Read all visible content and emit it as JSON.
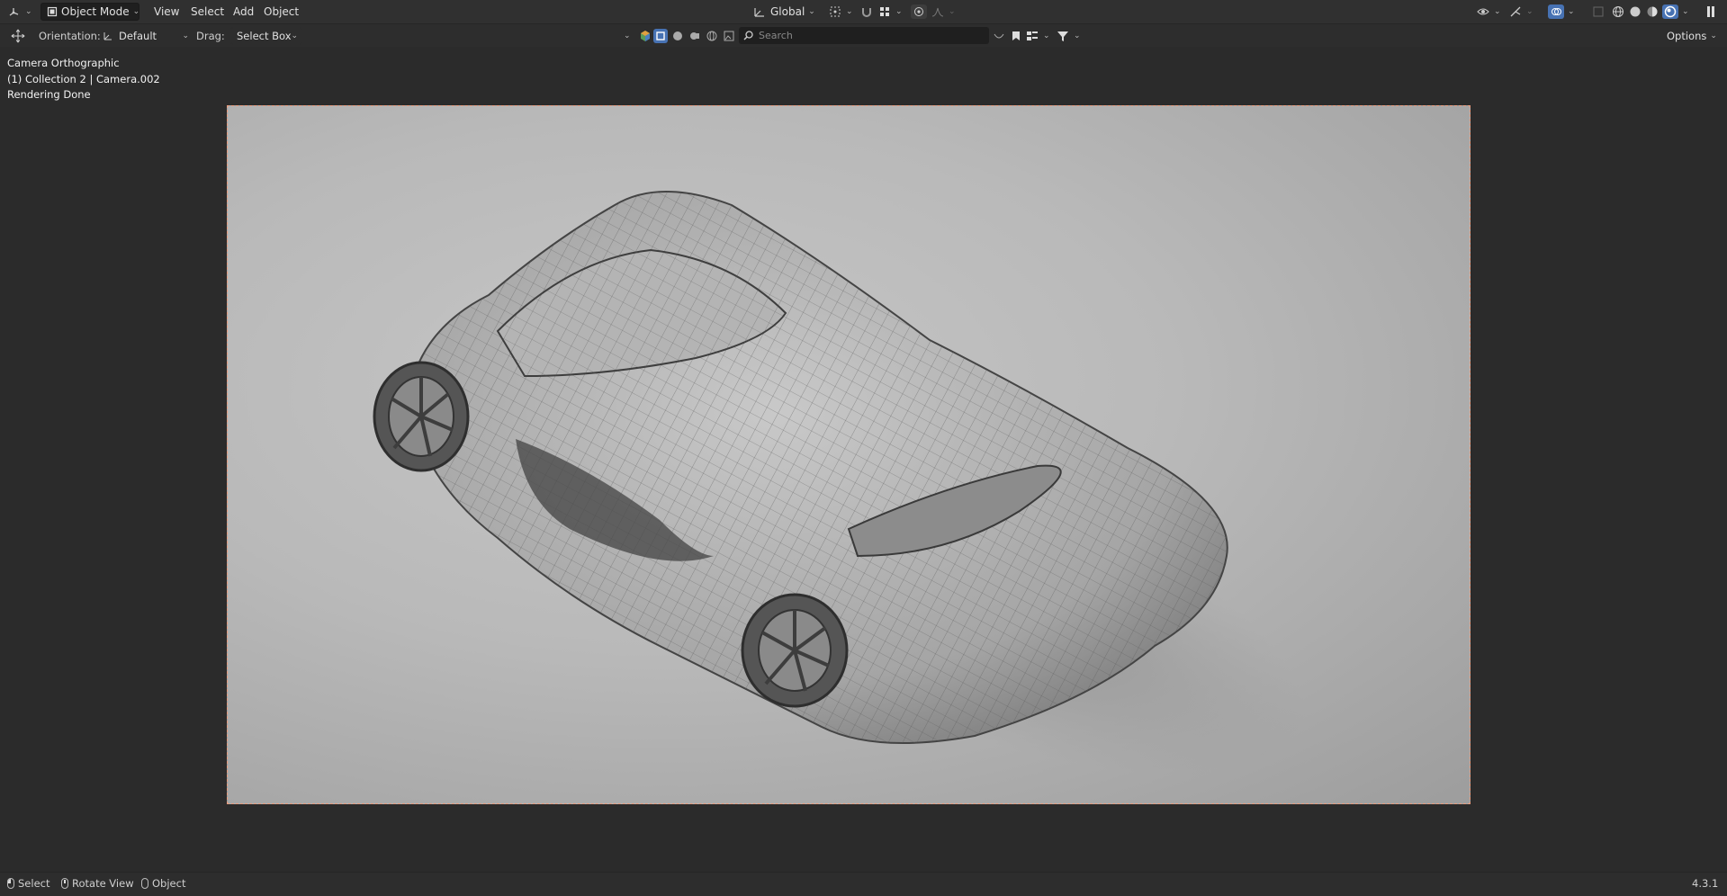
{
  "header": {
    "editor_type_icon": "viewport-3d-icon",
    "mode": "Object Mode",
    "menus": [
      "View",
      "Select",
      "Add",
      "Object"
    ],
    "orientation": "Global"
  },
  "tool_settings": {
    "orientation_label": "Orientation:",
    "orientation_value": "Default",
    "drag_label": "Drag:",
    "drag_value": "Select Box",
    "search_placeholder": "Search",
    "options_label": "Options"
  },
  "viewport": {
    "overlay_lines": [
      "Camera Orthographic",
      "(1) Collection 2 | Camera.002",
      "Rendering Done"
    ]
  },
  "statusbar": {
    "hints": [
      {
        "mouse": "left",
        "label": "Select"
      },
      {
        "mouse": "mid",
        "label": "Rotate View"
      },
      {
        "mouse": "right",
        "label": "Object"
      }
    ],
    "version": "4.3.1"
  },
  "colors": {
    "accent": "#4772b3",
    "camera_frame": "#e89a7c",
    "background": "#2b2b2b"
  }
}
